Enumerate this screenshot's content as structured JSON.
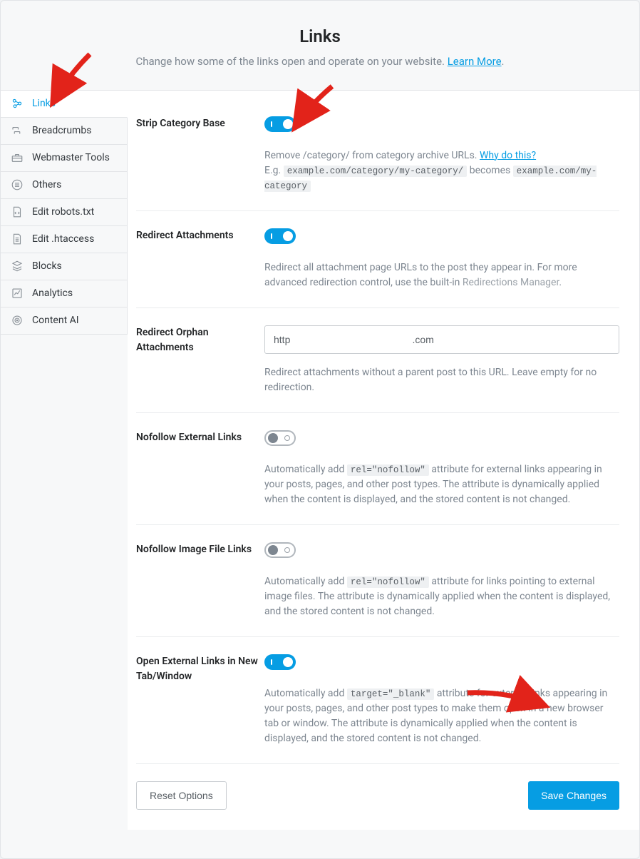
{
  "header": {
    "title": "Links",
    "subtitle_a": "Change how some of the links open and operate on your website. ",
    "learn_more": "Learn More",
    "subtitle_b": "."
  },
  "sidebar": {
    "items": [
      {
        "label": "Links",
        "icon": "links"
      },
      {
        "label": "Breadcrumbs",
        "icon": "breadcrumbs"
      },
      {
        "label": "Webmaster Tools",
        "icon": "toolbox"
      },
      {
        "label": "Others",
        "icon": "list"
      },
      {
        "label": "Edit robots.txt",
        "icon": "file-code"
      },
      {
        "label": "Edit .htaccess",
        "icon": "file-lines"
      },
      {
        "label": "Blocks",
        "icon": "blocks"
      },
      {
        "label": "Analytics",
        "icon": "chart"
      },
      {
        "label": "Content AI",
        "icon": "target"
      }
    ]
  },
  "rows": {
    "strip": {
      "label": "Strip Category Base",
      "desc_a": "Remove /category/ from category archive URLs. ",
      "why": "Why do this?",
      "eg": "E.g. ",
      "code1": "example.com/category/my-category/",
      "becomes": " becomes ",
      "code2": "example.com/my-category"
    },
    "redir_att": {
      "label": "Redirect Attachments",
      "desc_a": "Redirect all attachment page URLs to the post they appear in. For more advanced redirection control, use the built-in  ",
      "link": "Redirections Manager",
      "desc_b": "."
    },
    "orphan": {
      "label": "Redirect Orphan Attachments",
      "input_value": "http                                            .com",
      "desc": "Redirect attachments without a parent post to this URL. Leave empty for no redirection."
    },
    "nf_ext": {
      "label": "Nofollow External Links",
      "desc_a": "Automatically add ",
      "code": "rel=\"nofollow\"",
      "desc_b": " attribute for external links appearing in your posts, pages, and other post types. The attribute is dynamically applied when the content is displayed, and the stored content is not changed."
    },
    "nf_img": {
      "label": "Nofollow Image File Links",
      "desc_a": "Automatically add ",
      "code": "rel=\"nofollow\"",
      "desc_b": " attribute for links pointing to external image files. The attribute is dynamically applied when the content is displayed, and the stored content is not changed."
    },
    "newtab": {
      "label": "Open External Links in New Tab/Window",
      "desc_a": "Automatically add ",
      "code": "target=\"_blank\"",
      "desc_b": " attribute for external links appearing in your posts, pages, and other post types to make them open in a new browser tab or window. The attribute is dynamically applied when the content is displayed, and the stored content is not changed."
    }
  },
  "footer": {
    "reset": "Reset Options",
    "save": "Save Changes"
  }
}
